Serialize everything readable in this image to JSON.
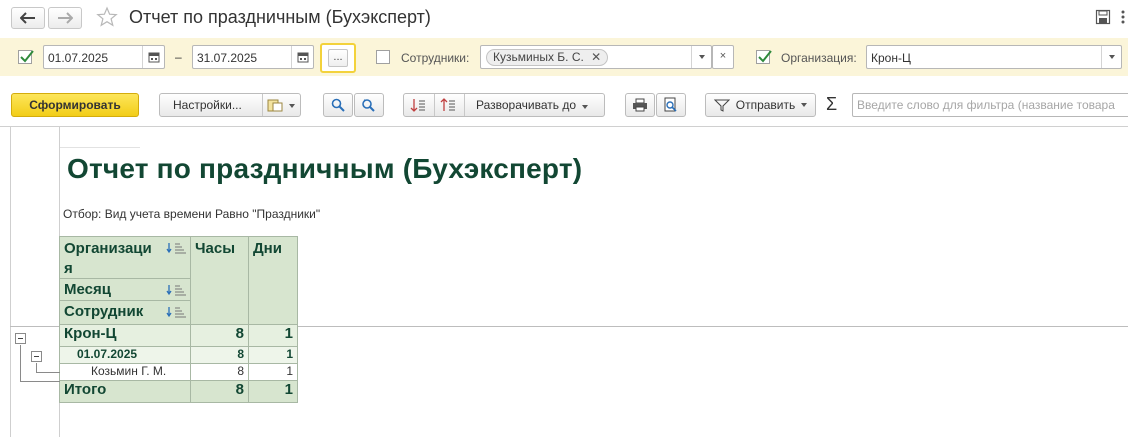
{
  "window": {
    "title": "Отчет по праздничным (Бухэксперт)"
  },
  "params": {
    "date_from": "01.07.2025",
    "date_sep": "–",
    "date_to": "31.07.2025",
    "ellipsis": "...",
    "employees_label": "Сотрудники:",
    "employee_tag": "Кузьминых Б. С.",
    "employees_clear": "×",
    "org_label": "Организация:",
    "org_value": "Крон-Ц"
  },
  "toolbar": {
    "generate": "Сформировать",
    "settings": "Настройки...",
    "expand_to": "Разворачивать до",
    "send": "Отправить",
    "filter_placeholder": "Введите слово для фильтра (название товара"
  },
  "report": {
    "title": "Отчет по праздничным (Бухэксперт)",
    "filter_text": "Отбор: Вид учета времени Равно \"Праздники\"",
    "headers": {
      "org_line1": "Организаци",
      "org_line2": "я",
      "month": "Месяц",
      "employee": "Сотрудник",
      "hours": "Часы",
      "days": "Дни"
    },
    "rows": {
      "org": {
        "name": "Крон-Ц",
        "hours": "8",
        "days": "1"
      },
      "month": {
        "name": "01.07.2025",
        "hours": "8",
        "days": "1"
      },
      "employee": {
        "name": "Козьмин Г. М.",
        "hours": "8",
        "days": "1"
      },
      "total": {
        "name": "Итого",
        "hours": "8",
        "days": "1"
      }
    }
  },
  "colors": {
    "accent_yellow": "#f2cd18",
    "params_bg": "#fbf5d9",
    "header_green": "#d7e5cf",
    "title_green": "#124733"
  }
}
